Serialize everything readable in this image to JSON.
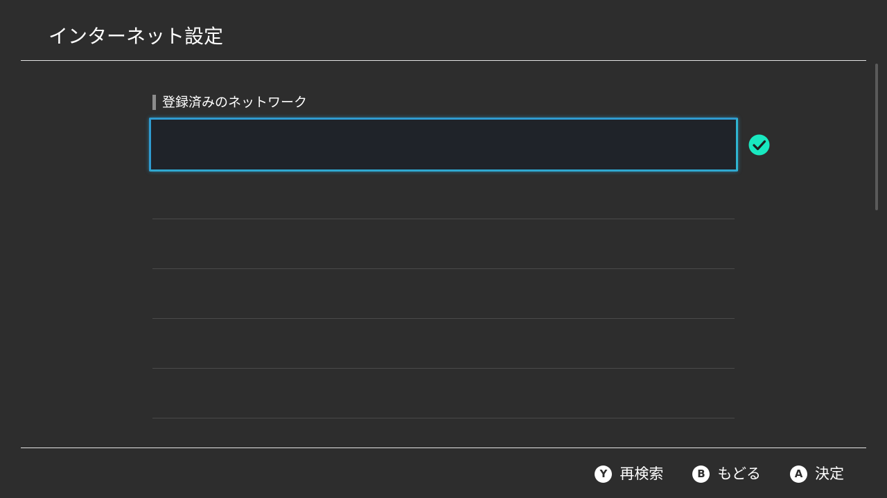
{
  "header": {
    "title": "インターネット設定"
  },
  "registered_networks": {
    "section_label": "登録済みのネットワーク",
    "items": [
      {
        "name": "",
        "selected": true,
        "connected": true,
        "status_icon": "check-circle-icon"
      },
      {
        "name": ""
      },
      {
        "name": ""
      },
      {
        "name": ""
      },
      {
        "name": ""
      },
      {
        "name": ""
      }
    ]
  },
  "footer": {
    "actions": [
      {
        "button": "Y",
        "label": "再検索"
      },
      {
        "button": "B",
        "label": "もどる"
      },
      {
        "button": "A",
        "label": "決定"
      }
    ]
  },
  "colors": {
    "background": "#2d2d2d",
    "selection_border": "#2f9bd0",
    "connected_check": "#19e8c0"
  }
}
